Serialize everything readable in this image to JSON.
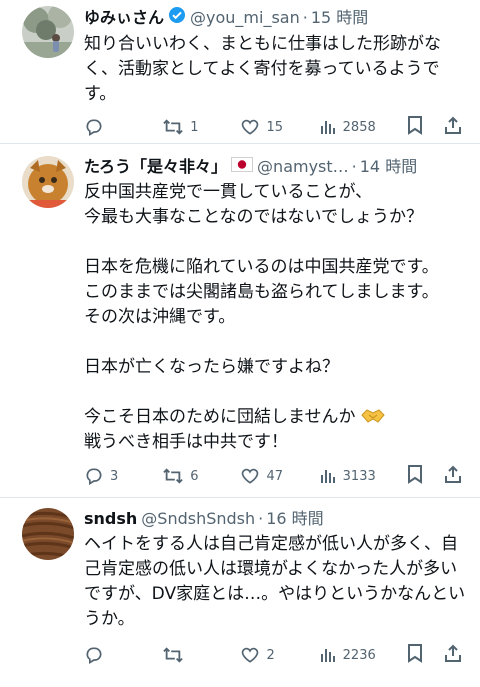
{
  "tweets": [
    {
      "name": "ゆみぃさん",
      "handle": "@you_mi_san",
      "dot": "·",
      "time": "15 時間",
      "text": "知り合いいわく、まともに仕事はした形跡がなく、活動家としてよく寄付を募っているようです。",
      "actions": {
        "replies": "",
        "reposts": "1",
        "likes": "15",
        "views": "2858"
      }
    },
    {
      "name": "たろう「是々非々」",
      "handle": "@namyst…",
      "dot": "·",
      "time": "14 時間",
      "text": "反中国共産党で一貫していることが、\n今最も大事なことなのではないでしょうか？\n\n日本を危機に陥れているのは中国共産党です。\nこのままでは尖閣諸島も盗られてしまします。\nその次は沖縄です。\n\n日本が亡くなったら嫌ですよね？\n\n今こそ日本のために団結しませんか",
      "text2": "戦うべき相手は中共です！",
      "actions": {
        "replies": "3",
        "reposts": "6",
        "likes": "47",
        "views": "3133"
      }
    },
    {
      "name": "sndsh",
      "handle": "@SndshSndsh",
      "dot": "·",
      "time": "16 時間",
      "text": "ヘイトをする人は自己肯定感が低い人が多く、自己肯定感の低い人は環境がよくなかった人が多いですが、DV家庭とは…。やはりというかなんというか。",
      "actions": {
        "replies": "",
        "reposts": "",
        "likes": "2",
        "views": "2236"
      }
    }
  ],
  "icons": [
    "reply-icon",
    "repost-icon",
    "like-icon",
    "views-icon",
    "bookmark-icon",
    "share-icon",
    "verified-badge-icon",
    "japan-flag-icon",
    "handshake-emoji-icon"
  ],
  "colors": {
    "text": "#0f1419",
    "secondary": "#536471",
    "divider": "#e1e6ea",
    "verified": "#1d9bf0"
  }
}
